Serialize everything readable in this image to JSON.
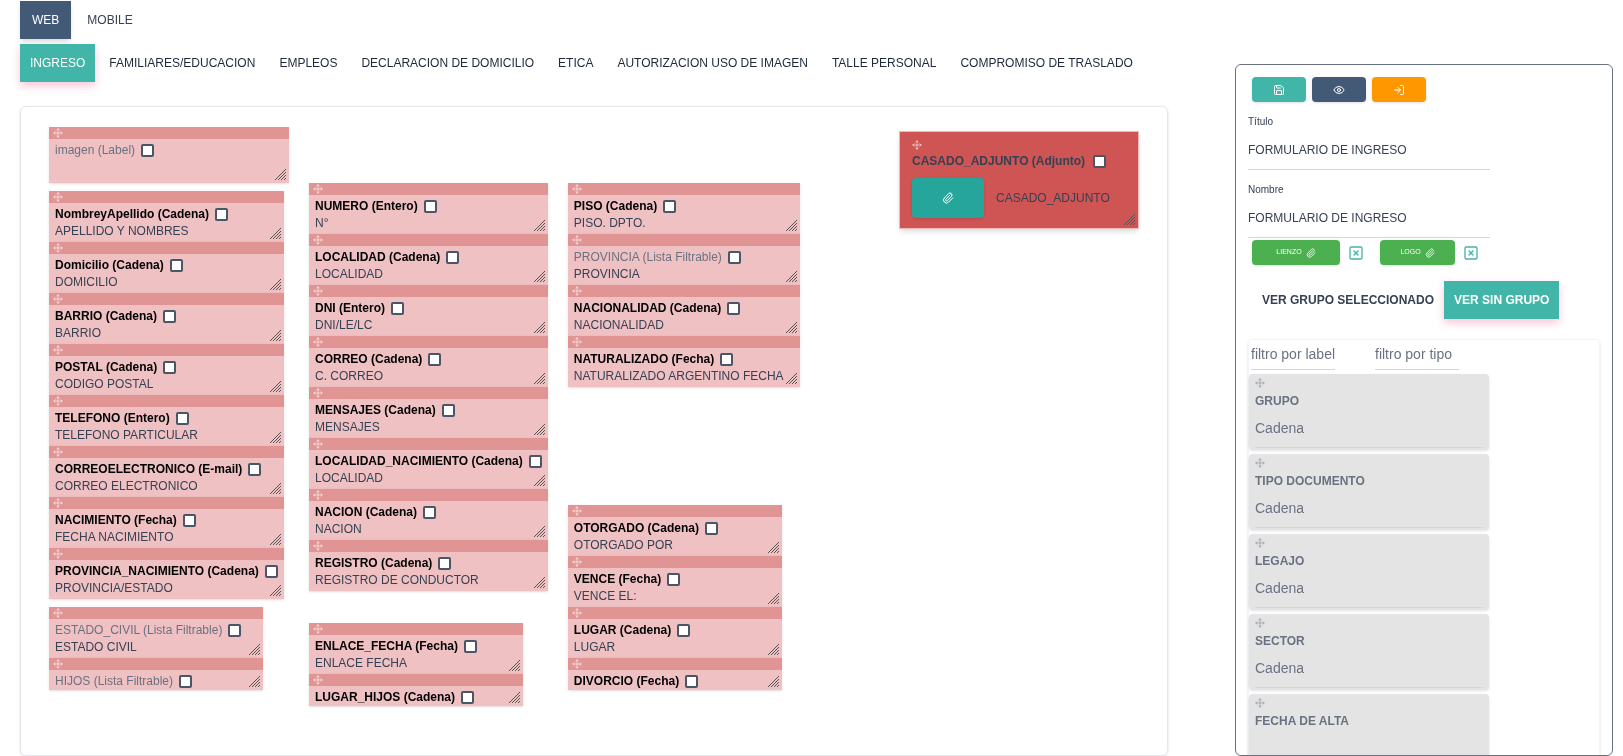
{
  "platform_tabs": [
    {
      "label": "WEB",
      "selected": true
    },
    {
      "label": "MOBILE",
      "selected": false
    }
  ],
  "section_tabs": [
    {
      "label": "INGRESO",
      "selected": true
    },
    {
      "label": "FAMILIARES/EDUCACION",
      "selected": false
    },
    {
      "label": "EMPLEOS",
      "selected": false
    },
    {
      "label": "DECLARACION DE DOMICILIO",
      "selected": false
    },
    {
      "label": "ETICA",
      "selected": false
    },
    {
      "label": "AUTORIZACION USO DE IMAGEN",
      "selected": false
    },
    {
      "label": "TALLE PERSONAL",
      "selected": false
    },
    {
      "label": "COMPROMISO DE TRASLADO",
      "selected": false
    }
  ],
  "canvas": {
    "columns": [
      {
        "groups": [
          {
            "fields": [
              {
                "label": "imagen (Label)",
                "dimmed": true,
                "checked": false
              }
            ]
          },
          {
            "fields": [
              {
                "label": "NombreyApellido (Cadena)",
                "value": "APELLIDO Y NOMBRES",
                "dimmed": false,
                "checked": false
              },
              {
                "label": "Domicilio (Cadena)",
                "value": "DOMICILIO",
                "dimmed": false,
                "checked": false
              },
              {
                "label": "BARRIO (Cadena)",
                "value": "BARRIO",
                "dimmed": false,
                "checked": false
              },
              {
                "label": "POSTAL (Cadena)",
                "value": "CODIGO POSTAL",
                "dimmed": false,
                "checked": false
              },
              {
                "label": "TELEFONO (Entero)",
                "value": "TELEFONO PARTICULAR",
                "dimmed": false,
                "checked": false
              },
              {
                "label": "CORREOELECTRONICO (E-mail)",
                "value": "CORREO ELECTRONICO",
                "dimmed": false,
                "checked": false
              },
              {
                "label": "NACIMIENTO (Fecha)",
                "value": "FECHA NACIMIENTO",
                "dimmed": false,
                "checked": false
              },
              {
                "label": "PROVINCIA_NACIMIENTO (Cadena)",
                "value": "PROVINCIA/ESTADO",
                "dimmed": false,
                "checked": false
              }
            ]
          },
          {
            "fields": [
              {
                "label": "ESTADO_CIVIL (Lista Filtrable)",
                "value": "ESTADO CIVIL",
                "dimmed": true,
                "checked": false
              },
              {
                "label": "HIJOS (Lista Filtrable)",
                "dimmed": true,
                "checked": false
              }
            ]
          }
        ]
      },
      {
        "groups": [
          {
            "fields": [
              {
                "label": "NUMERO (Entero)",
                "value": "N°",
                "dimmed": false,
                "checked": false
              },
              {
                "label": "LOCALIDAD (Cadena)",
                "value": "LOCALIDAD",
                "dimmed": false,
                "checked": false
              },
              {
                "label": "DNI (Entero)",
                "value": "DNI/LE/LC",
                "dimmed": false,
                "checked": false
              },
              {
                "label": "CORREO (Cadena)",
                "value": "C. CORREO",
                "dimmed": false,
                "checked": false
              },
              {
                "label": "MENSAJES (Cadena)",
                "value": "MENSAJES",
                "dimmed": false,
                "checked": false
              },
              {
                "label": "LOCALIDAD_NACIMIENTO (Cadena)",
                "value": "LOCALIDAD",
                "dimmed": false,
                "checked": false
              },
              {
                "label": "NACION (Cadena)",
                "value": "NACION",
                "dimmed": false,
                "checked": false
              },
              {
                "label": "REGISTRO (Cadena)",
                "value": "REGISTRO DE CONDUCTOR",
                "dimmed": false,
                "checked": false
              }
            ]
          },
          {
            "fields": [
              {
                "label": "ENLACE_FECHA (Fecha)",
                "value": "ENLACE FECHA",
                "dimmed": false,
                "checked": false
              },
              {
                "label": "LUGAR_HIJOS (Cadena)",
                "dimmed": false,
                "checked": false
              }
            ]
          }
        ]
      },
      {
        "groups": [
          {
            "fields": [
              {
                "label": "PISO (Cadena)",
                "value": "PISO. DPTO.",
                "dimmed": false,
                "checked": false
              },
              {
                "label": "PROVINCIA (Lista Filtrable)",
                "value": "PROVINCIA",
                "dimmed": true,
                "checked": false
              },
              {
                "label": "NACIONALIDAD (Cadena)",
                "value": "NACIONALIDAD",
                "dimmed": false,
                "checked": false
              },
              {
                "label": "NATURALIZADO (Fecha)",
                "value": "NATURALIZADO ARGENTINO FECHA",
                "dimmed": false,
                "checked": false
              }
            ]
          },
          {
            "fields": [
              {
                "label": "OTORGADO (Cadena)",
                "value": "OTORGADO POR",
                "dimmed": false,
                "checked": false
              },
              {
                "label": "VENCE (Fecha)",
                "value": "VENCE EL:",
                "dimmed": false,
                "checked": false
              },
              {
                "label": "LUGAR (Cadena)",
                "value": "LUGAR",
                "dimmed": false,
                "checked": false
              },
              {
                "label": "DIVORCIO (Fecha)",
                "dimmed": false,
                "checked": false
              }
            ]
          }
        ]
      }
    ],
    "attachment": {
      "label": "CASADO_ADJUNTO (Adjunto)",
      "checked": false,
      "file_label": "CASADO_ADJUNTO"
    }
  },
  "side_panel": {
    "title_field": {
      "label": "Título",
      "value": "FORMULARIO DE INGRESO"
    },
    "name_field": {
      "label": "Nombre",
      "value": "FORMULARIO DE INGRESO"
    },
    "uploads": [
      {
        "label": "LIENZO"
      },
      {
        "label": "LOGO"
      }
    ],
    "view_tabs": [
      {
        "label": "VER GRUPO SELECCIONADO",
        "selected": false
      },
      {
        "label": "VER SIN GRUPO",
        "selected": true
      }
    ],
    "filters": [
      {
        "placeholder": "filtro por label"
      },
      {
        "placeholder": "filtro por tipo"
      }
    ],
    "items": [
      {
        "label": "GRUPO",
        "type": "Cadena"
      },
      {
        "label": "TIPO DOCUMENTO",
        "type": "Cadena"
      },
      {
        "label": "LEGAJO",
        "type": "Cadena"
      },
      {
        "label": "SECTOR",
        "type": "Cadena"
      },
      {
        "label": "FECHA DE ALTA"
      }
    ]
  }
}
